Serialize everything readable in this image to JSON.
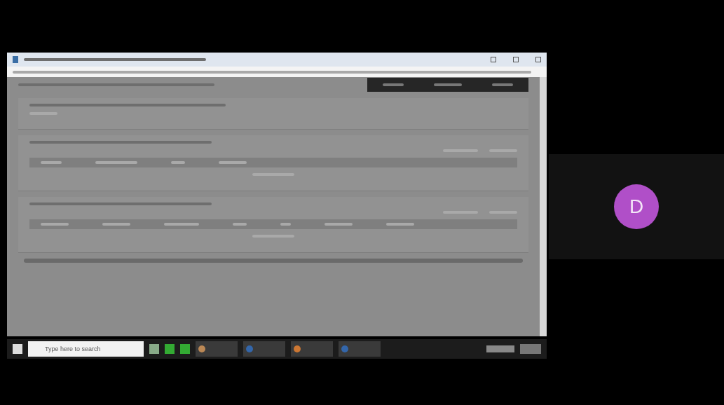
{
  "shared_screen": {
    "taskbar": {
      "search": {
        "placeholder": "Type here to search"
      }
    }
  },
  "participant": {
    "initial": "D",
    "color": "#b04fc8"
  }
}
